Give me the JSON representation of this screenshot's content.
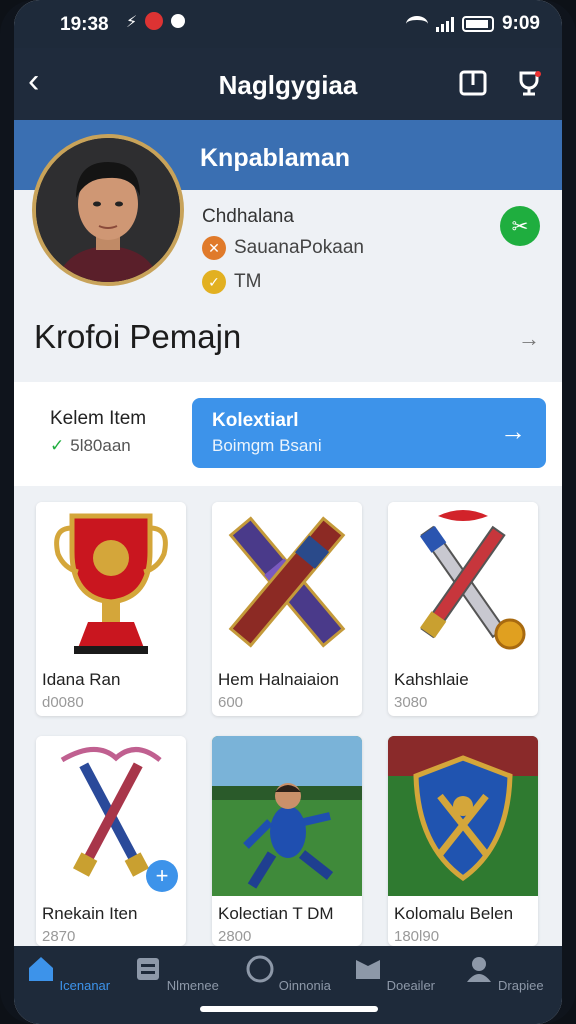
{
  "status": {
    "time": "19:38",
    "right_time": "9:09"
  },
  "header": {
    "title": "Naglgygiaa"
  },
  "profile": {
    "band_title": "Knpablaman",
    "name": "Chdhalana",
    "row1": "SauanaPokaan",
    "row2": "TM"
  },
  "section": {
    "title": "Krofoi Pemajn"
  },
  "collection": {
    "left_label": "Kelem Item",
    "left_sub": "5l80aan",
    "cta_title": "Kolextiarl",
    "cta_sub": "Boimgm Bsani"
  },
  "items": [
    {
      "name": "Idana Ran",
      "num": "d0080"
    },
    {
      "name": "Hem Halnaiaion",
      "num": "600"
    },
    {
      "name": "Kahshlaie",
      "num": "3080"
    },
    {
      "name": "Rnekain Iten",
      "num": "2870"
    },
    {
      "name": "Kolectian T DM",
      "num": "2800"
    },
    {
      "name": "Kolomalu Belen",
      "num": "180l90"
    }
  ],
  "nav": [
    {
      "label": "Icenanar",
      "icon": "home-icon"
    },
    {
      "label": "Nlmenee",
      "icon": "list-icon"
    },
    {
      "label": "Oinnonia",
      "icon": "circle-icon"
    },
    {
      "label": "Doeailer",
      "icon": "mail-icon"
    },
    {
      "label": "Drapiee",
      "icon": "profile-icon"
    }
  ],
  "colors": {
    "accent": "#3d93ea",
    "header": "#1f2b3c",
    "band": "#3a6fb2",
    "green": "#1fae3f"
  }
}
